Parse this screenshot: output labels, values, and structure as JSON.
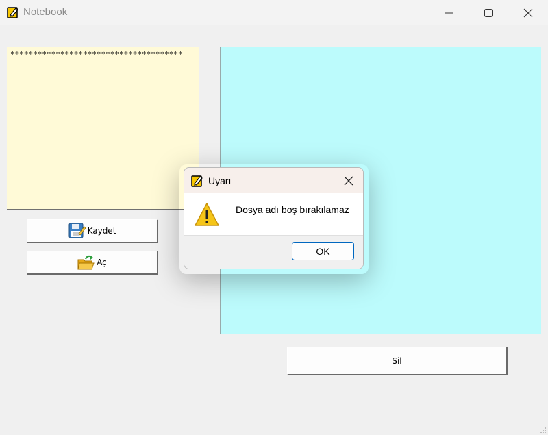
{
  "window": {
    "title": "Notebook",
    "icon": "notepad-pencil-icon",
    "controls": [
      "minimize-icon",
      "maximize-icon",
      "close-icon"
    ]
  },
  "editor": {
    "text": "**************************************"
  },
  "buttons": {
    "save_label": "Kaydet",
    "save_icon": "floppy-save-icon",
    "open_label": "Aç",
    "open_icon": "open-folder-icon",
    "delete_label": "Sil"
  },
  "dialog": {
    "title": "Uyarı",
    "message": "Dosya adı boş bırakılamaz",
    "ok_label": "OK",
    "icon": "warning-icon"
  },
  "colors": {
    "editor_bg": "#fffad7",
    "list_bg": "#bcfbfc",
    "window_bg": "#f0f0f0",
    "accent": "#0067c0"
  }
}
